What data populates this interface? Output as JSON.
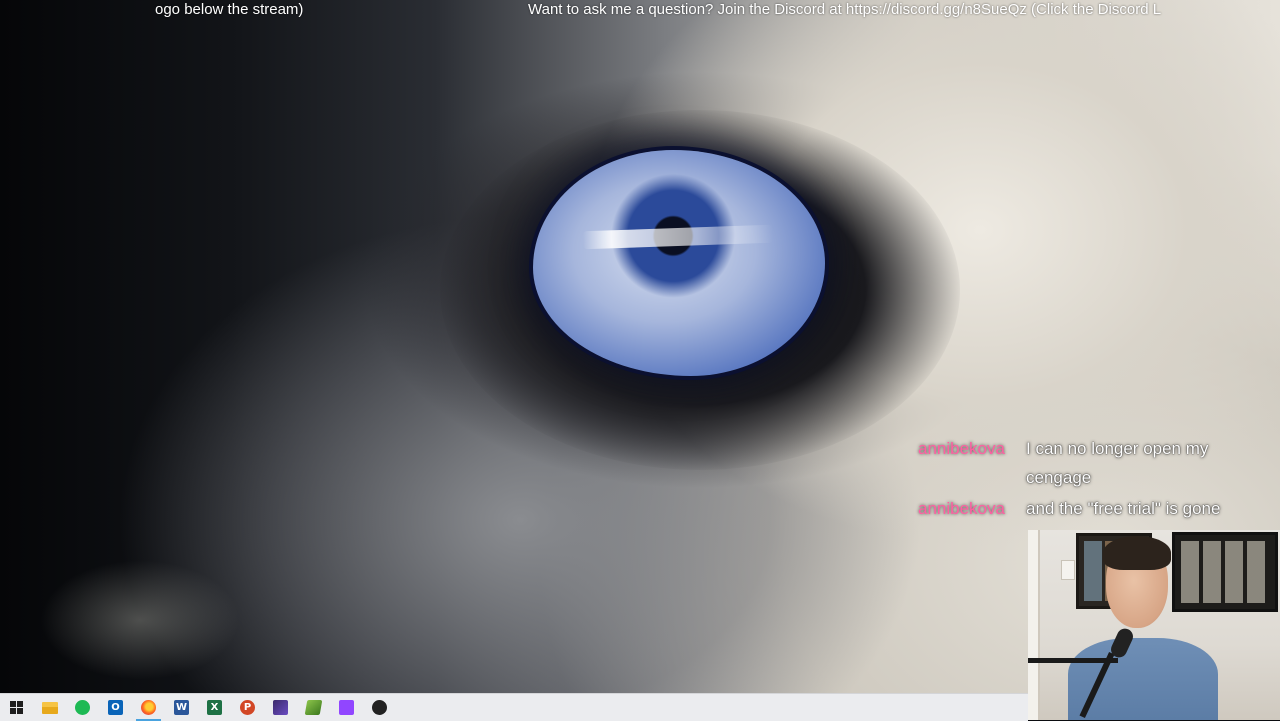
{
  "ticker": {
    "left_text": "ogo below the stream)",
    "right_text": "Want to ask me a question? Join the Discord at https://discord.gg/n8SueQz (Click the Discord L"
  },
  "chat": {
    "messages": [
      {
        "user": "annibekova",
        "text": "I can no longer open my cengage"
      },
      {
        "user": "annibekova",
        "text": "and the \"free trial\" is gone"
      }
    ],
    "username_color": "#ff5fa2"
  },
  "taskbar": {
    "apps": [
      {
        "name": "windows-start",
        "icon": "windows-icon"
      },
      {
        "name": "file-explorer",
        "icon": "folder-icon"
      },
      {
        "name": "spotify",
        "icon": "spotify-icon"
      },
      {
        "name": "outlook",
        "icon": "outlook-icon",
        "glyph": "O"
      },
      {
        "name": "firefox",
        "icon": "firefox-icon"
      },
      {
        "name": "word",
        "icon": "word-icon",
        "glyph": "W"
      },
      {
        "name": "excel",
        "icon": "excel-icon",
        "glyph": "X"
      },
      {
        "name": "powerpoint",
        "icon": "powerpoint-icon",
        "glyph": "P"
      },
      {
        "name": "davinci-resolve",
        "icon": "davinci-icon"
      },
      {
        "name": "notepad-plus-plus",
        "icon": "notepad-icon"
      },
      {
        "name": "twitch",
        "icon": "twitch-icon"
      },
      {
        "name": "obs",
        "icon": "obs-icon"
      }
    ],
    "active_app": "firefox",
    "accent": "#4aa3df"
  }
}
